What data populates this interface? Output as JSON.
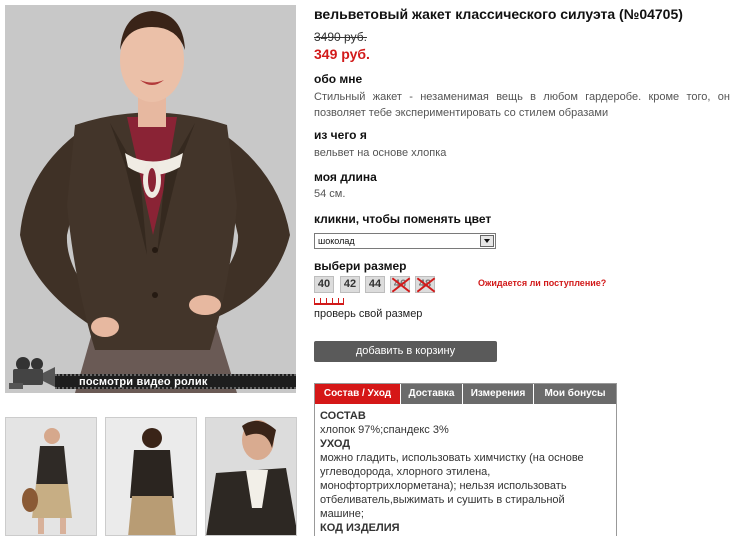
{
  "product": {
    "title": "вельветовый жакет классического силуэта (№04705)",
    "old_price": "3490 руб.",
    "new_price": "349 руб."
  },
  "about": {
    "heading": "обо мне",
    "text": "Стильный жакет - незаменимая вещь в любом гардеробе. кроме того, он позволяет тебе экспериментировать со стилем образами"
  },
  "material": {
    "heading": "из чего я",
    "text": "вельвет на основе хлопка"
  },
  "length": {
    "heading": "моя длина",
    "text": "54 см."
  },
  "color": {
    "heading": "кликни, чтобы поменять цвет",
    "selected": "шоколад"
  },
  "size": {
    "heading": "выбери размер",
    "options": [
      {
        "label": "40",
        "available": true
      },
      {
        "label": "42",
        "available": true
      },
      {
        "label": "44",
        "available": true
      },
      {
        "label": "46",
        "available": false
      },
      {
        "label": "48",
        "available": false
      }
    ],
    "awaiting_link": "Ожидается ли поступление?",
    "check_size_link": "проверь свой размер"
  },
  "cart": {
    "button_label": "добавить в корзину"
  },
  "video": {
    "label": "посмотри видео ролик"
  },
  "tabs": [
    {
      "label": "Состав / Уход",
      "active": true
    },
    {
      "label": "Доставка",
      "active": false
    },
    {
      "label": "Измерения",
      "active": false
    },
    {
      "label": "Мои бонусы",
      "active": false
    }
  ],
  "composition": {
    "heading": "СОСТАВ",
    "text": "хлопок 97%;спандекс 3%",
    "care_heading": "УХОД",
    "care_text": "можно гладить, использовать химчистку (на основе углеводорода, хлорного этилена, монофтортрихлорметана); нельзя использовать отбеливатель,выжимать и сушить в стиральной машине;",
    "code_heading": "КОД ИЗДЕЛИЯ"
  },
  "colors": {
    "accent": "#d21a1a",
    "tab_inactive": "#6b6b6b",
    "button": "#5a5a5a"
  },
  "icons": [
    "video-camera-icon",
    "ruler-icon",
    "dropdown-arrow-icon"
  ]
}
